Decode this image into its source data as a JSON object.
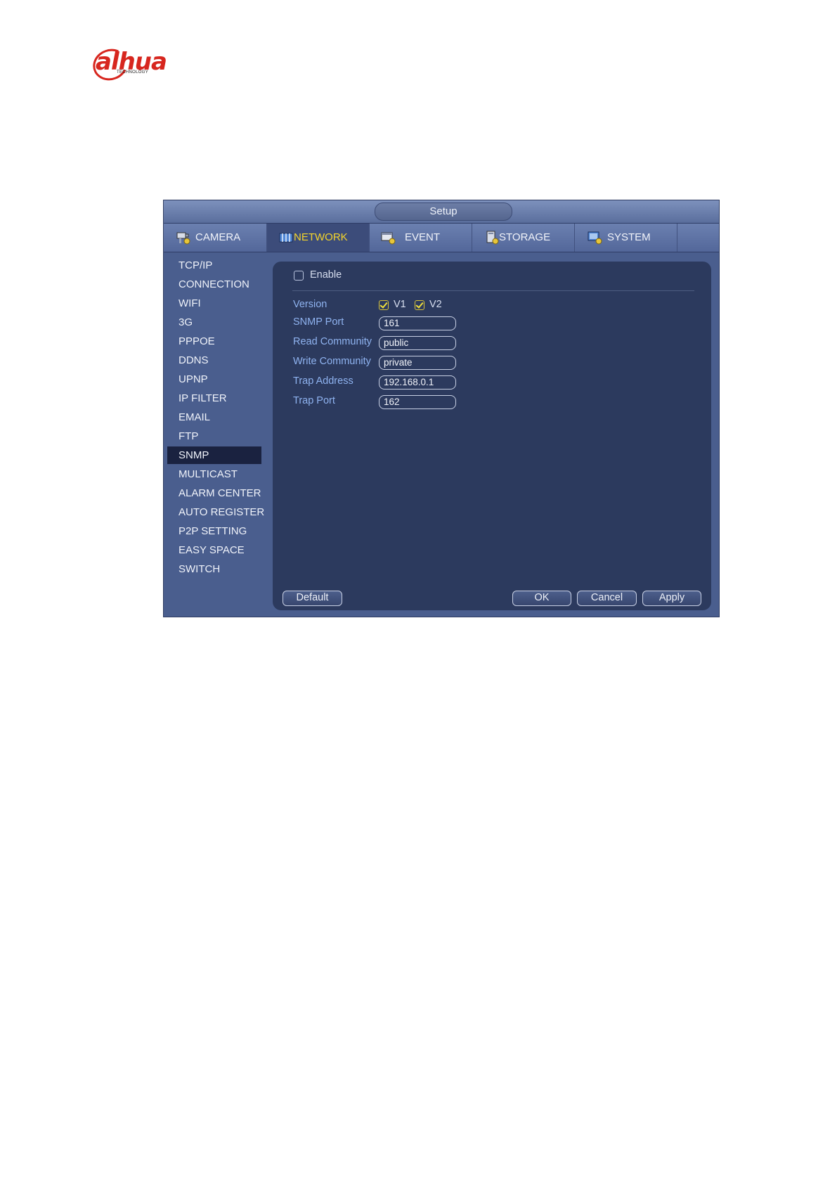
{
  "brand": {
    "name": "alhua",
    "subtitle": "TECHNOLOGY"
  },
  "window": {
    "title": "Setup"
  },
  "tabs": [
    {
      "label": "CAMERA",
      "icon": "camera-icon"
    },
    {
      "label": "NETWORK",
      "icon": "network-icon"
    },
    {
      "label": "EVENT",
      "icon": "event-icon"
    },
    {
      "label": "STORAGE",
      "icon": "storage-icon"
    },
    {
      "label": "SYSTEM",
      "icon": "system-icon"
    }
  ],
  "active_tab": "NETWORK",
  "sidebar": {
    "items": [
      {
        "label": "TCP/IP"
      },
      {
        "label": "CONNECTION"
      },
      {
        "label": "WIFI"
      },
      {
        "label": "3G"
      },
      {
        "label": "PPPOE"
      },
      {
        "label": "DDNS"
      },
      {
        "label": "UPNP"
      },
      {
        "label": "IP FILTER"
      },
      {
        "label": "EMAIL"
      },
      {
        "label": "FTP"
      },
      {
        "label": "SNMP"
      },
      {
        "label": "MULTICAST"
      },
      {
        "label": "ALARM CENTER"
      },
      {
        "label": "AUTO REGISTER"
      },
      {
        "label": "P2P SETTING"
      },
      {
        "label": "EASY SPACE"
      },
      {
        "label": "SWITCH"
      }
    ],
    "active": "SNMP"
  },
  "snmp": {
    "enable": {
      "label": "Enable",
      "checked": false
    },
    "version": {
      "label": "Version",
      "v1_label": "V1",
      "v1_checked": true,
      "v2_label": "V2",
      "v2_checked": true
    },
    "fields": [
      {
        "label": "SNMP Port",
        "value": "161"
      },
      {
        "label": "Read Community",
        "value": "public"
      },
      {
        "label": "Write Community",
        "value": "private"
      },
      {
        "label": "Trap Address",
        "value": "192.168.0.1"
      },
      {
        "label": "Trap Port",
        "value": "162"
      }
    ]
  },
  "buttons": {
    "default": "Default",
    "ok": "OK",
    "cancel": "Cancel",
    "apply": "Apply"
  },
  "colors": {
    "active_tab_text": "#f5d52a",
    "field_label": "#8fb3f0",
    "window_bg": "#4a5e8e",
    "panel_bg": "#2c3a5e"
  }
}
